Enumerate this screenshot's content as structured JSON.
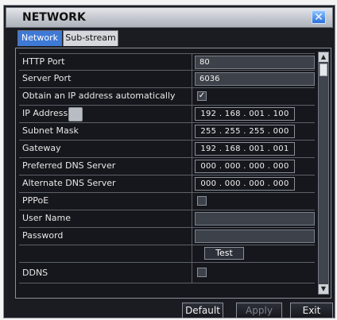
{
  "window": {
    "title": "NETWORK"
  },
  "tabs": [
    {
      "label": "Network",
      "active": true
    },
    {
      "label": "Sub-stream",
      "active": false
    }
  ],
  "rows": [
    {
      "label": "HTTP Port",
      "value": "80"
    },
    {
      "label": "Server Port",
      "value": "6036"
    },
    {
      "label": "Obtain an IP address automatically",
      "checked": true,
      "check_glyph": "✓"
    },
    {
      "label": "IP Address",
      "value": "192 . 168 . 001 . 100"
    },
    {
      "label": "Subnet Mask",
      "value": "255 . 255 . 255 . 000"
    },
    {
      "label": "Gateway",
      "value": "192 . 168 . 001 . 001"
    },
    {
      "label": "Preferred DNS Server",
      "value": "000 . 000 . 000 . 000"
    },
    {
      "label": "Alternate DNS Server",
      "value": "000 . 000 . 000 . 000"
    },
    {
      "label": "PPPoE",
      "checked": false
    },
    {
      "label": "User Name",
      "value": ""
    },
    {
      "label": "Password",
      "value": ""
    },
    {
      "label": "",
      "button": "Test"
    },
    {
      "label": "DDNS",
      "checked": false
    }
  ],
  "footer": {
    "default_label": "Default",
    "apply_label": "Apply",
    "exit_label": "Exit"
  },
  "colors": {
    "accent": "#3f79d6",
    "window_bg": "#1a1c22",
    "field_bg": "#3d4149"
  },
  "icons": {
    "close": "close-icon",
    "scroll_up": "arrow-up-icon",
    "scroll_down": "arrow-down-icon"
  }
}
